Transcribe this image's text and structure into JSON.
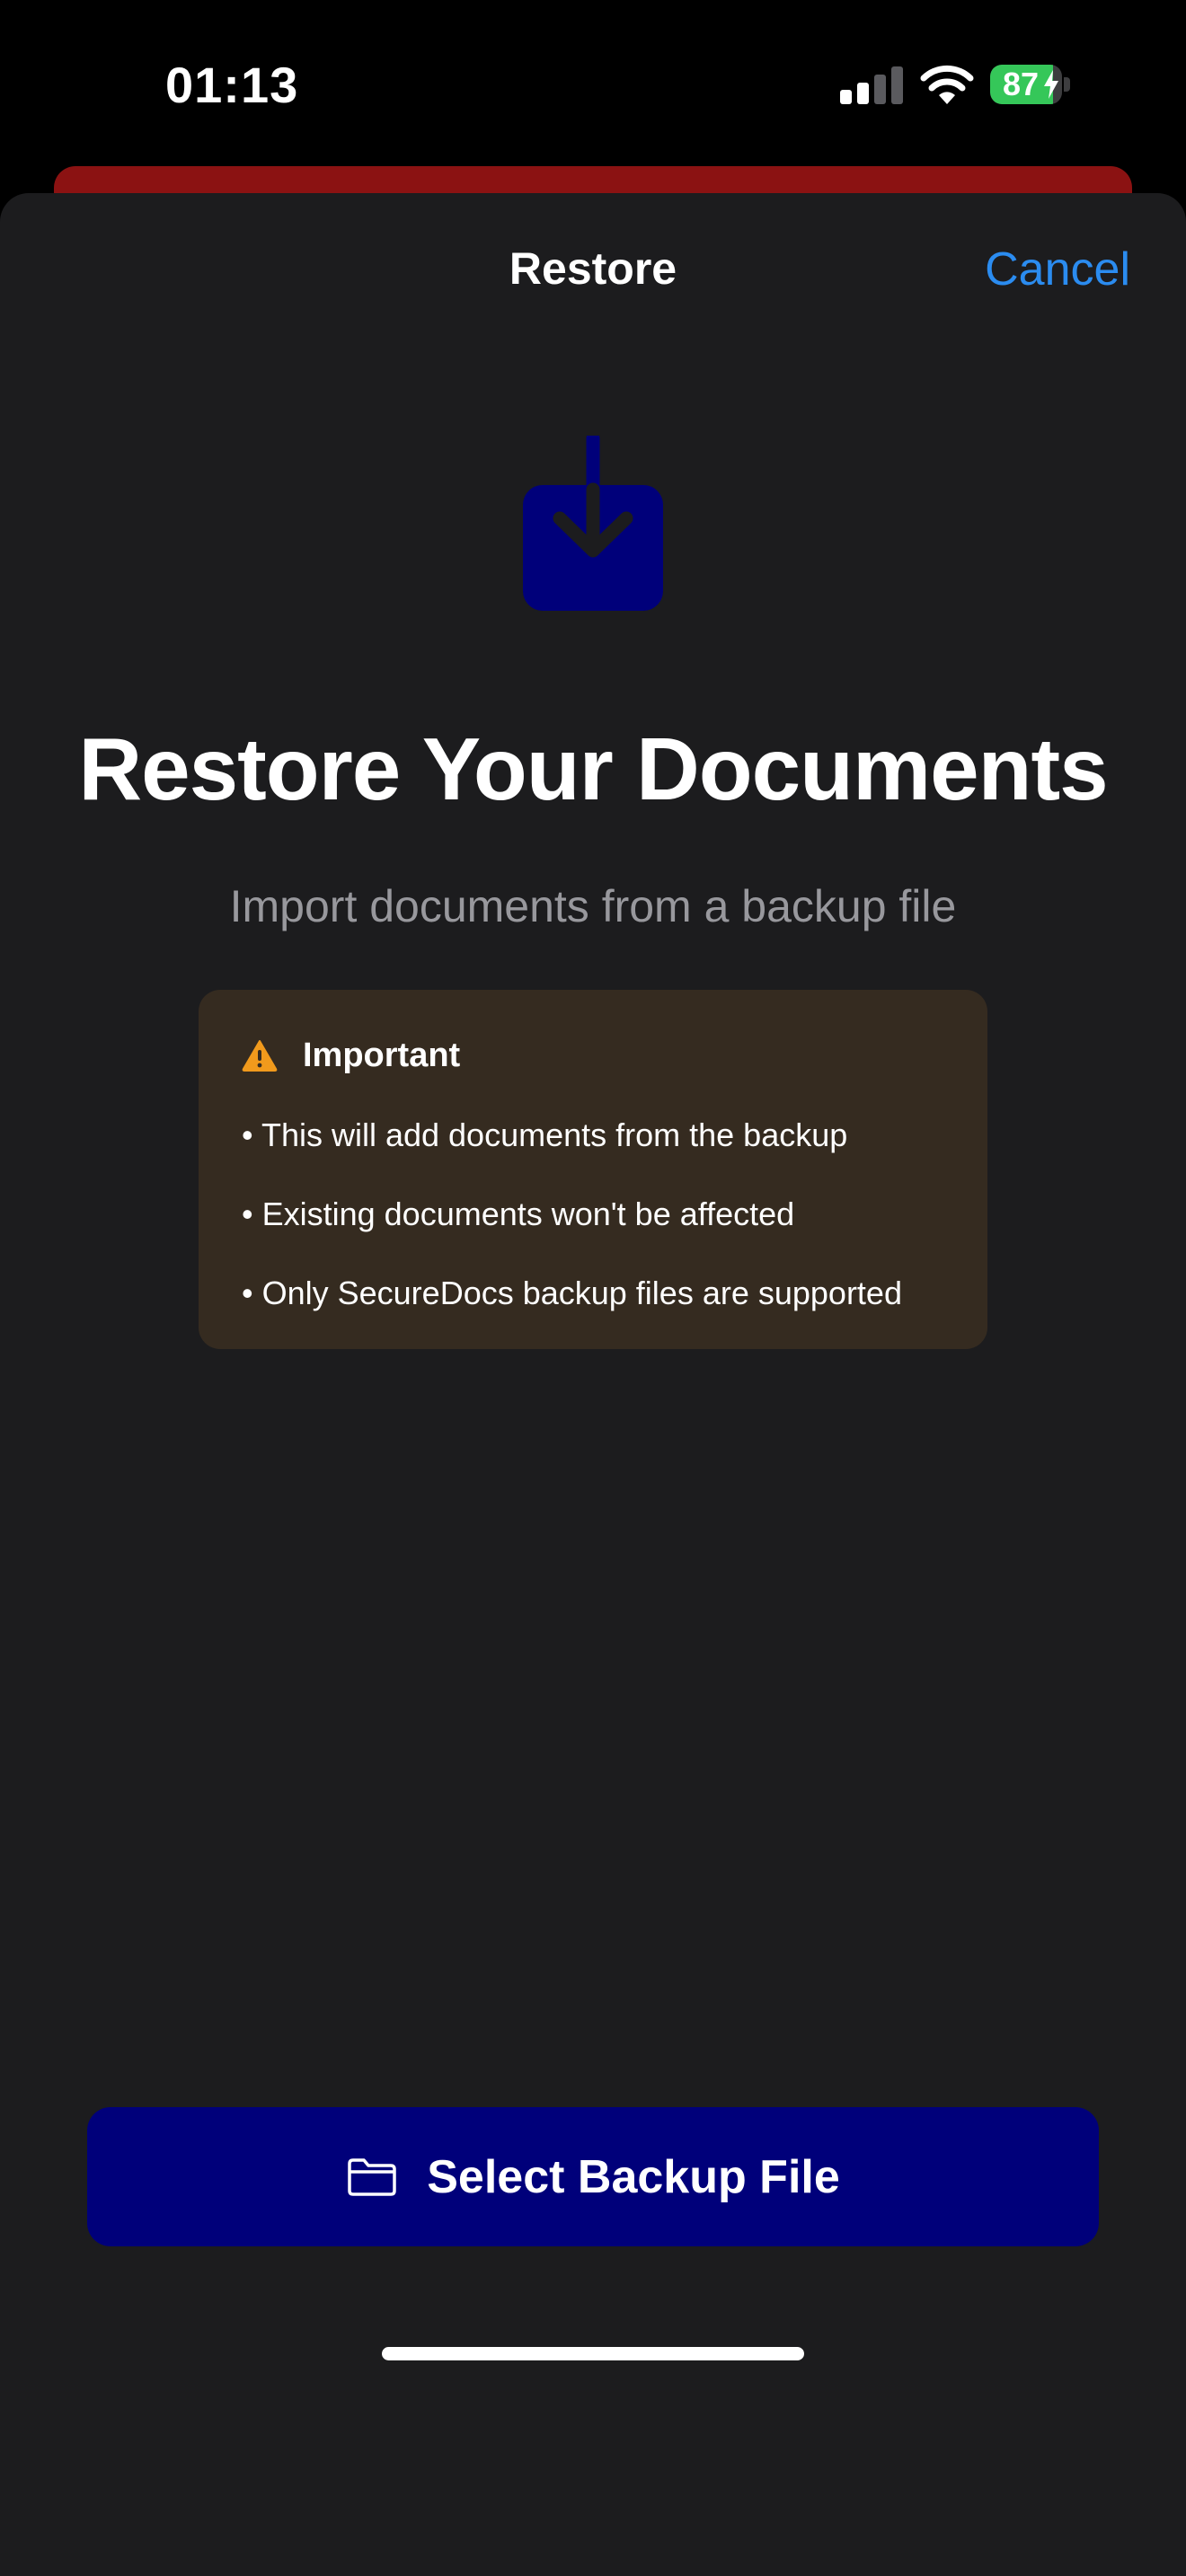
{
  "status_bar": {
    "time": "01:13",
    "battery_percent": "87",
    "battery_level": 0.87,
    "charging": true,
    "icons": [
      "cellular-signal-icon",
      "wifi-icon",
      "battery-icon",
      "charging-bolt-icon"
    ]
  },
  "nav": {
    "title": "Restore",
    "cancel_label": "Cancel"
  },
  "hero": {
    "icon": "download-tray-icon",
    "title": "Restore Your Documents",
    "subtitle": "Import documents from a backup file"
  },
  "important": {
    "icon": "warning-triangle-icon",
    "title": "Important",
    "items": [
      "• This will add documents from the backup",
      "• Existing documents won't be affected",
      "• Only SecureDocs backup files are supported"
    ]
  },
  "action": {
    "icon": "folder-icon",
    "label": "Select Backup File"
  },
  "colors": {
    "accent_blue": "#2b8cf0",
    "button_navy": "#00007a",
    "sheet_background": "#1c1c1e",
    "warning_orange": "#f19a1c",
    "warning_box": "#352b20",
    "battery_green": "#35c759",
    "card_red": "#8b1212"
  }
}
